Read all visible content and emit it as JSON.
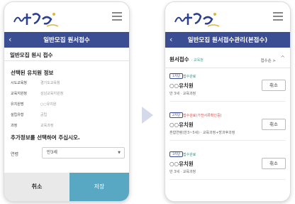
{
  "left_screen": {
    "nav_title": "일반모집 원서접수",
    "back_glyph": "‹",
    "section_title": "일반모집 원시 접수",
    "selected_info": {
      "heading": "선택된 유치원 정보",
      "rows": [
        {
          "label": "시도교육청",
          "value": "경기도교육청"
        },
        {
          "label": "교육지원청",
          "value": "성남교육지원청"
        },
        {
          "label": "유치원명",
          "value": "○○유치원"
        },
        {
          "label": "설립유형",
          "value": "공립"
        },
        {
          "label": "과정",
          "value": "교육과정"
        }
      ]
    },
    "extra_info_heading": "추가정보를 선택하여 주십시오.",
    "age_field": {
      "label": "연령",
      "value": "만3세"
    },
    "cancel_label": "취소",
    "save_label": "저장"
  },
  "right_screen": {
    "nav_title": "일반모집 원서접수관리(본접수)",
    "back_glyph": "‹",
    "list_title": "원서접수",
    "list_subtitle": "- 교육청",
    "sort_label": "접수순 >",
    "collapse_glyph": "^",
    "applications": [
      {
        "rank": "1지망",
        "status": "접수완료",
        "status_color": "#3a8f86",
        "name": "○○유치원",
        "detail": "만 3세 · 교육과정",
        "cancel_label": "취소"
      },
      {
        "rank": "2지망",
        "status": "접수완료(가전서류확인중)",
        "status_color": "#d9534f",
        "name": "○○유치원",
        "detail": "혼합연령(만3~5세) · 교육과정+방과후과정",
        "cancel_label": "취소"
      },
      {
        "rank": "3지망",
        "status": "접수완료",
        "status_color": "#3a8f86",
        "name": "○○유치원",
        "detail": "만 3세 · 교육과정",
        "cancel_label": "취소"
      }
    ]
  },
  "colors": {
    "nav_bar": "#3b4d93",
    "save_button": "#58a7c3",
    "cancel_button": "#e9e9e9",
    "status_ok": "#3a8f86",
    "status_pending": "#d9534f"
  },
  "icons": [
    "logo-icon",
    "menu-icon",
    "back-icon",
    "chevron-down-icon",
    "arrow-right-icon"
  ]
}
